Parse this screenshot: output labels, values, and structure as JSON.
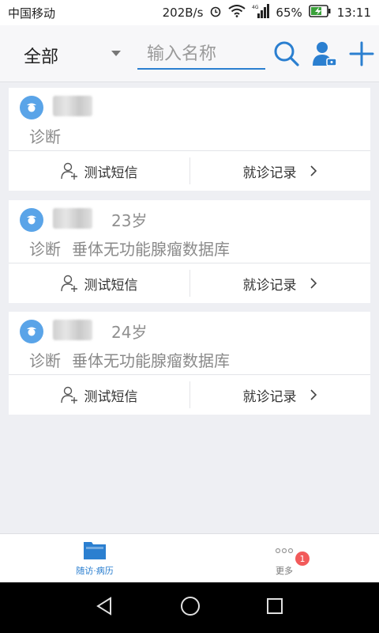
{
  "status_bar": {
    "carrier": "中国移动",
    "speed": "202B/s",
    "network": "4G",
    "battery": "65%",
    "time": "13:11"
  },
  "header": {
    "filter_label": "全部",
    "search_placeholder": "输入名称",
    "icons": [
      "search-icon",
      "user-icon",
      "add-icon"
    ]
  },
  "patients": [
    {
      "name": "李宁",
      "age": "",
      "diagnosis_label": "诊断",
      "diagnosis": "",
      "sms_label": "测试短信",
      "record_label": "就诊记录"
    },
    {
      "name": "张三",
      "age": "23岁",
      "diagnosis_label": "诊断",
      "diagnosis": "垂体无功能腺瘤数据库",
      "sms_label": "测试短信",
      "record_label": "就诊记录"
    },
    {
      "name": "李四",
      "age": "24岁",
      "diagnosis_label": "诊断",
      "diagnosis": "垂体无功能腺瘤数据库",
      "sms_label": "测试短信",
      "record_label": "就诊记录"
    }
  ],
  "bottom_nav": {
    "items": [
      {
        "label": "随访·病历",
        "icon": "folder-icon",
        "active": true
      },
      {
        "label": "更多",
        "icon": "more-icon",
        "active": false,
        "badge": "1"
      }
    ]
  },
  "colors": {
    "accent": "#2b7fd0",
    "badge": "#f25a5a",
    "background": "#eeeff3"
  }
}
